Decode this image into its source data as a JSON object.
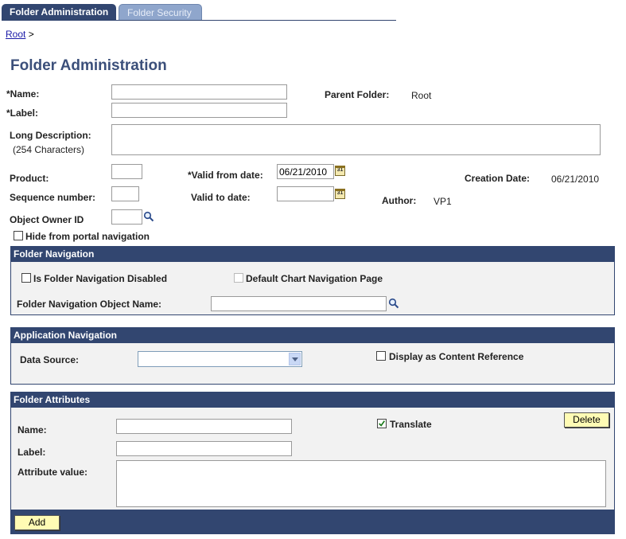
{
  "tabs": [
    {
      "label": "Folder Administration",
      "active": true
    },
    {
      "label": "Folder Security",
      "active": false
    }
  ],
  "breadcrumb": {
    "root_link": "Root",
    "separator": ">"
  },
  "page_title": "Folder Administration",
  "form": {
    "name_label": "*Name:",
    "name_value": "",
    "label_label": "*Label:",
    "label_value": "",
    "parent_folder_label": "Parent Folder:",
    "parent_folder_value": "Root",
    "long_desc_label": "Long Description:",
    "long_desc_hint": "(254 Characters)",
    "long_desc_value": "",
    "product_label": "Product:",
    "product_value": "",
    "valid_from_label": "*Valid from date:",
    "valid_from_value": "06/21/2010",
    "creation_date_label": "Creation Date:",
    "creation_date_value": "06/21/2010",
    "sequence_label": "Sequence number:",
    "sequence_value": "",
    "valid_to_label": "Valid to date:",
    "valid_to_value": "",
    "author_label": "Author:",
    "author_value": "VP1",
    "owner_label": "Object Owner ID",
    "owner_value": "",
    "hide_label": "Hide from portal navigation",
    "calendar_glyph": "31"
  },
  "folder_navigation": {
    "title": "Folder Navigation",
    "disabled_label": "Is Folder Navigation Disabled",
    "default_chart_label": "Default Chart Navigation Page",
    "object_name_label": "Folder Navigation Object Name:",
    "object_name_value": ""
  },
  "application_navigation": {
    "title": "Application Navigation",
    "data_source_label": "Data Source:",
    "data_source_value": "",
    "display_content_label": "Display as Content Reference"
  },
  "folder_attributes": {
    "title": "Folder Attributes",
    "name_label": "Name:",
    "name_value": "",
    "translate_label": "Translate",
    "translate_checked": true,
    "delete_label": "Delete",
    "label_label": "Label:",
    "label_value": "",
    "attr_value_label": "Attribute value:",
    "attr_value": "",
    "add_label": "Add"
  },
  "colors": {
    "header_bg": "#324670",
    "button_bg": "#fffbb4",
    "title_color": "#3b4f7a",
    "link_color": "#1a1aa8"
  }
}
